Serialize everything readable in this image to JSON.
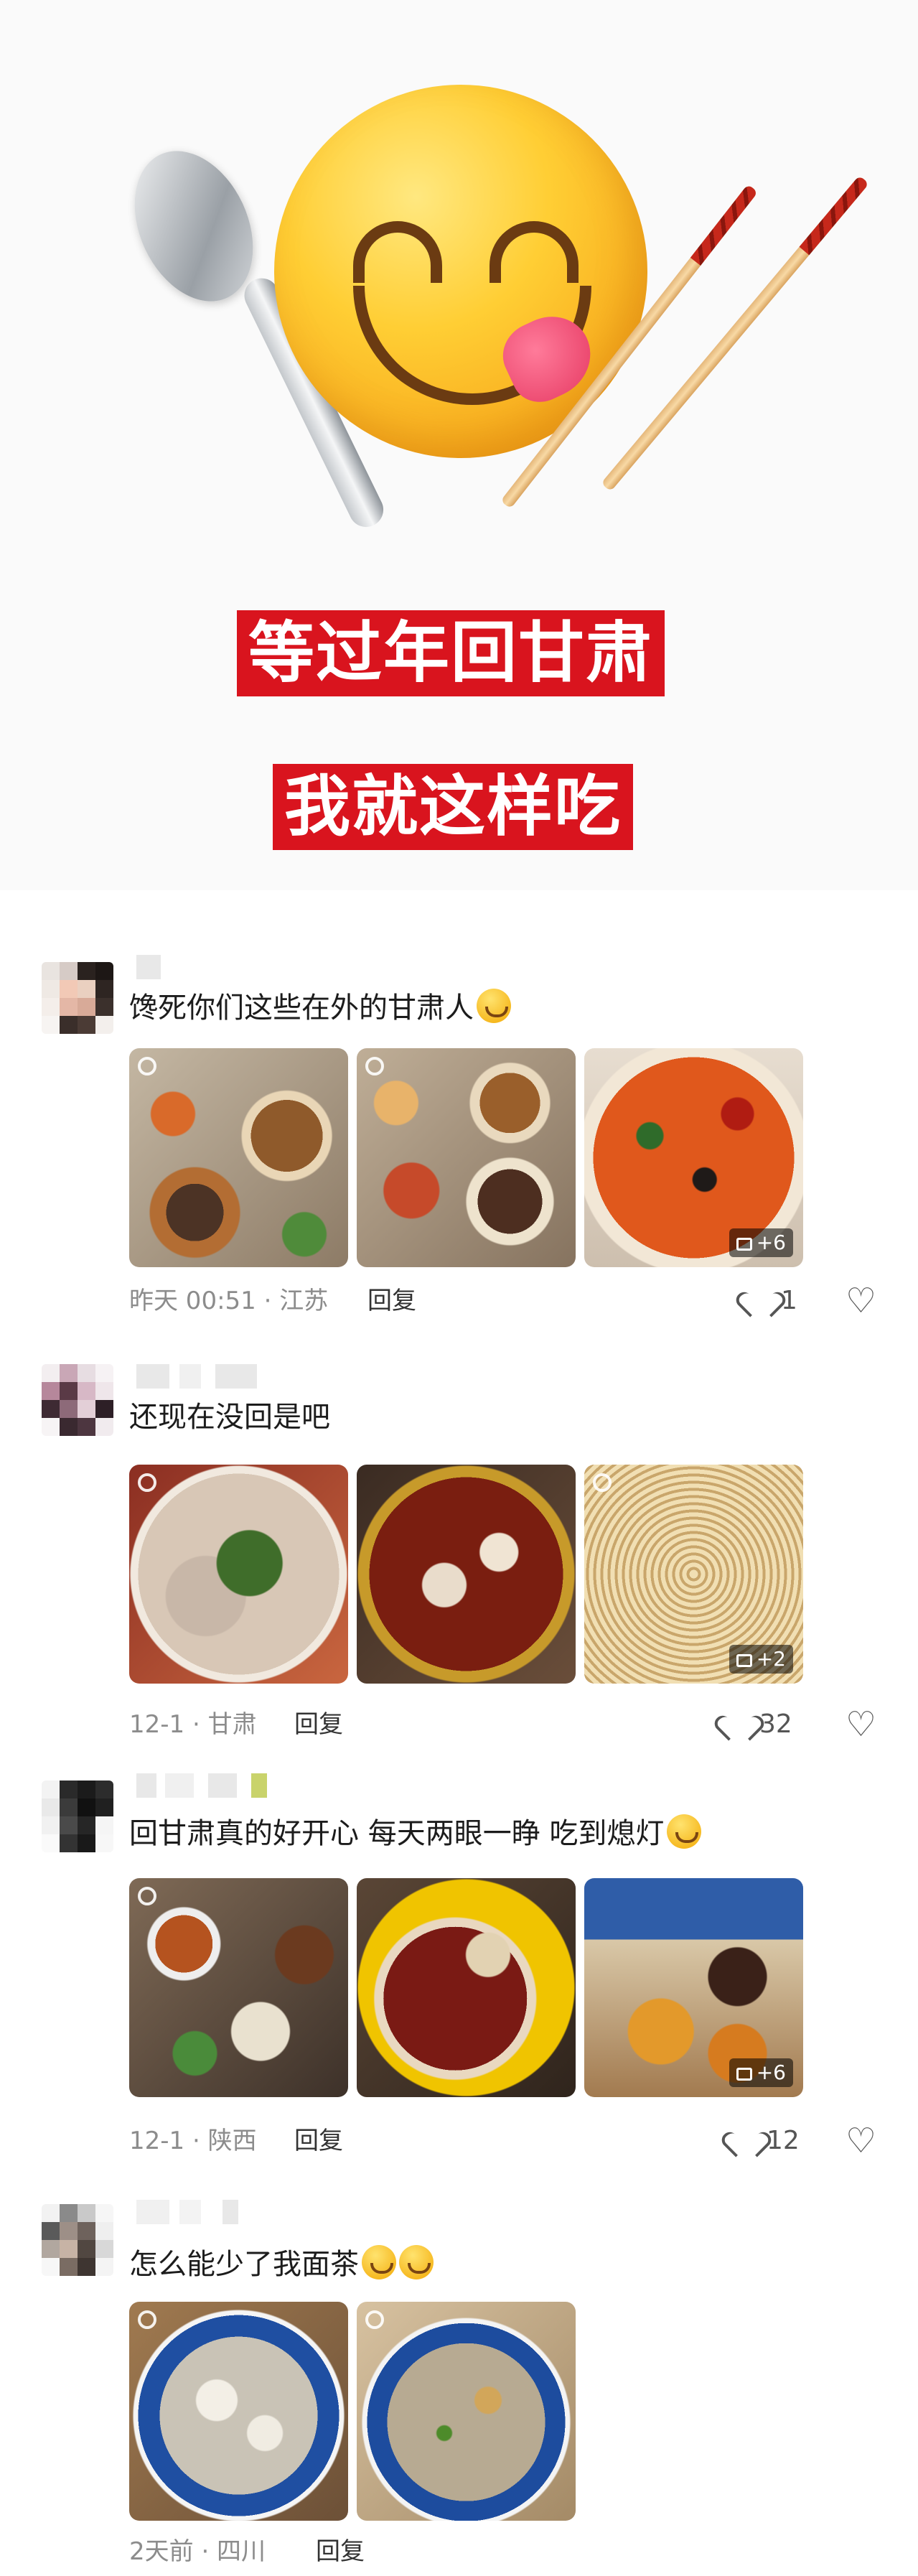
{
  "hero": {
    "banner1": "等过年回甘肃",
    "banner2": "我就这样吃"
  },
  "comments": [
    {
      "text": "馋死你们这些在外的甘肃人",
      "meta": "昨天 00:51 · 江苏",
      "reply": "回复",
      "likes": "1",
      "more": "+6"
    },
    {
      "text": "还现在没回是吧",
      "meta": "12-1 · 甘肃",
      "reply": "回复",
      "likes": "32",
      "more": "+2"
    },
    {
      "text": "回甘肃真的好开心 每天两眼一睁 吃到熄灯",
      "meta": "12-1 · 陕西",
      "reply": "回复",
      "likes": "12",
      "more": "+6"
    },
    {
      "text": "怎么能少了我面茶",
      "meta": "2天前 · 四川",
      "reply": "回复"
    }
  ],
  "icons": {
    "like": "heart-icon",
    "dislike": "broken-heart-icon",
    "more_images": "gallery-icon",
    "live_photo": "live-photo-icon"
  },
  "colors": {
    "banner_bg": "#d9141e",
    "banner_text": "#ffffff",
    "meta_text": "#8c8c8c"
  }
}
